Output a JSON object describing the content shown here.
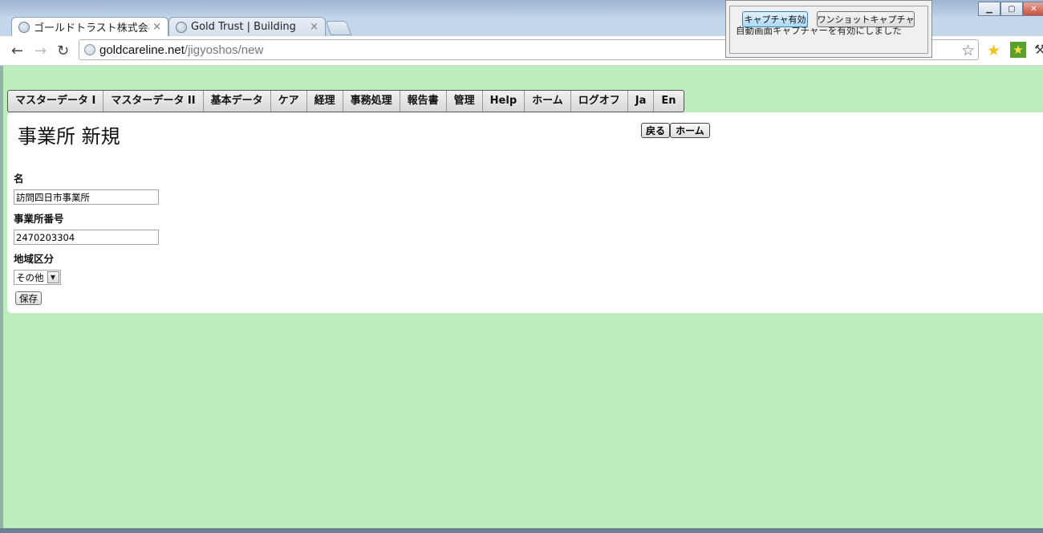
{
  "tabs": [
    {
      "label": "ゴールドトラスト株式会社",
      "close": "×",
      "active": true
    },
    {
      "label": "Gold Trust | Building",
      "close": "×",
      "active": false
    }
  ],
  "toolbar": {
    "back_icon": "arrow-left-icon",
    "forward_icon": "arrow-right-icon",
    "reload_icon": "reload-icon",
    "url_host": "goldcareline.net",
    "url_path": "/jigyoshos/new",
    "bookmark_icon": "star-outline-icon",
    "ext1_icon": "star-icon",
    "ext2_icon": "green-star-icon",
    "wrench_icon": "wrench-icon"
  },
  "capture_popup": {
    "enable_label": "キャプチャ有効",
    "oneshot_label": "ワンショットキャプチャ",
    "message": "自動画面キャプチャーを有効にしました"
  },
  "menu": {
    "items": [
      "マスターデータ I",
      "マスターデータ II",
      "基本データ",
      "ケア",
      "経理",
      "事務処理",
      "報告書",
      "管理",
      "Help",
      "ホーム",
      "ログオフ",
      "Ja",
      "En"
    ]
  },
  "page": {
    "title": "事業所 新規",
    "back_button": "戻る",
    "home_button": "ホーム",
    "fields": {
      "name_label": "名",
      "name_value": "訪問四日市事業所",
      "number_label": "事業所番号",
      "number_value": "2470203304",
      "region_label": "地域区分",
      "region_value": "その他"
    },
    "save_button": "保存"
  },
  "colors": {
    "page_bg": "#bdedbd",
    "content_bg": "#ffffff"
  }
}
